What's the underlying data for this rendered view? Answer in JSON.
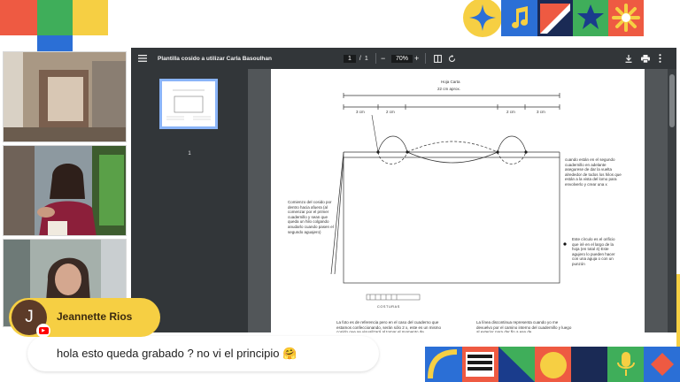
{
  "colors": {
    "accent_yellow": "#f6cf43",
    "viewer_bg": "#525659",
    "toolbar_bg": "#323639",
    "thumb_border": "#8ab4f8",
    "youtube_red": "#ff0000"
  },
  "viewer": {
    "title": "Plantilla cosido a utilizar Carla Basoulhan",
    "page_current": "1",
    "page_separator": "/",
    "page_total": "1",
    "zoom": "70%",
    "thumbnail_number": "1",
    "icons": {
      "menu": "menu-icon",
      "zoom_out": "minus-icon",
      "zoom_in": "plus-icon",
      "fit": "fit-page-icon",
      "rotate": "rotate-icon",
      "download": "download-icon",
      "print": "print-icon",
      "more": "more-vert-icon"
    }
  },
  "document": {
    "heading": "Hoja Carta",
    "width_label": "22 cm aprox.",
    "measure_left_1": "3 cm",
    "measure_left_2": "2 cm",
    "measure_right_1": "2 cm",
    "measure_right_2": "3 cm",
    "note_left": "Comienzo del cosido por dentro hacia afuera (al comenzar por el primer cuadernillo y sean que queda un hilo colgando anudarlo cuando pasen el segundo aguajero)",
    "note_right_top": "cuando están en el segundo cuadernillo en adelante asegurese de dar la vuelta alrededor de todos los hilos que están a la vista del lomo para envolverlo y crear una x",
    "note_right_bottom": "Este círculo es el orificio que iré en el largo de la hoja (en total 4) Este agujero lo pueden hacer con una aguja o con un punzón",
    "figure_caption": "COSTURAS",
    "para_left": "La foto es de referencia pero en el caso del cuaderno que estamos confeccionando, serán sólo 2 x, este es un mismo cosido que se visualizará al tomar el momento de",
    "para_right": "La línea discontinua representa cuando yo me devuelvo por el camino interno del cuadernillo y luego al exterior para dar fin a ese de"
  },
  "chat": {
    "avatar_letter": "J",
    "platform_icon": "youtube-icon",
    "author": "Jeannette Rios",
    "message": "hola esto queda grabado ? no vi el principio 🤗"
  }
}
